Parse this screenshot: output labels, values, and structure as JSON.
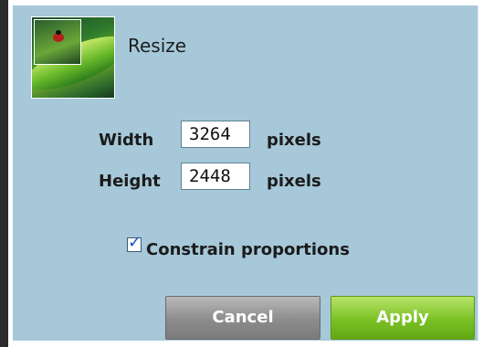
{
  "dialog": {
    "title": "Resize",
    "thumbnail_icon": "ladybug-on-leaf-image"
  },
  "fields": {
    "width_label": "Width",
    "width_value": "3264",
    "height_label": "Height",
    "height_value": "2448",
    "unit": "pixels"
  },
  "constrain": {
    "label": "Constrain proportions",
    "checked": true
  },
  "buttons": {
    "cancel": "Cancel",
    "apply": "Apply"
  },
  "colors": {
    "panel": "#a6c8d9",
    "apply": "#7ac124",
    "cancel": "#8c8c8c"
  }
}
